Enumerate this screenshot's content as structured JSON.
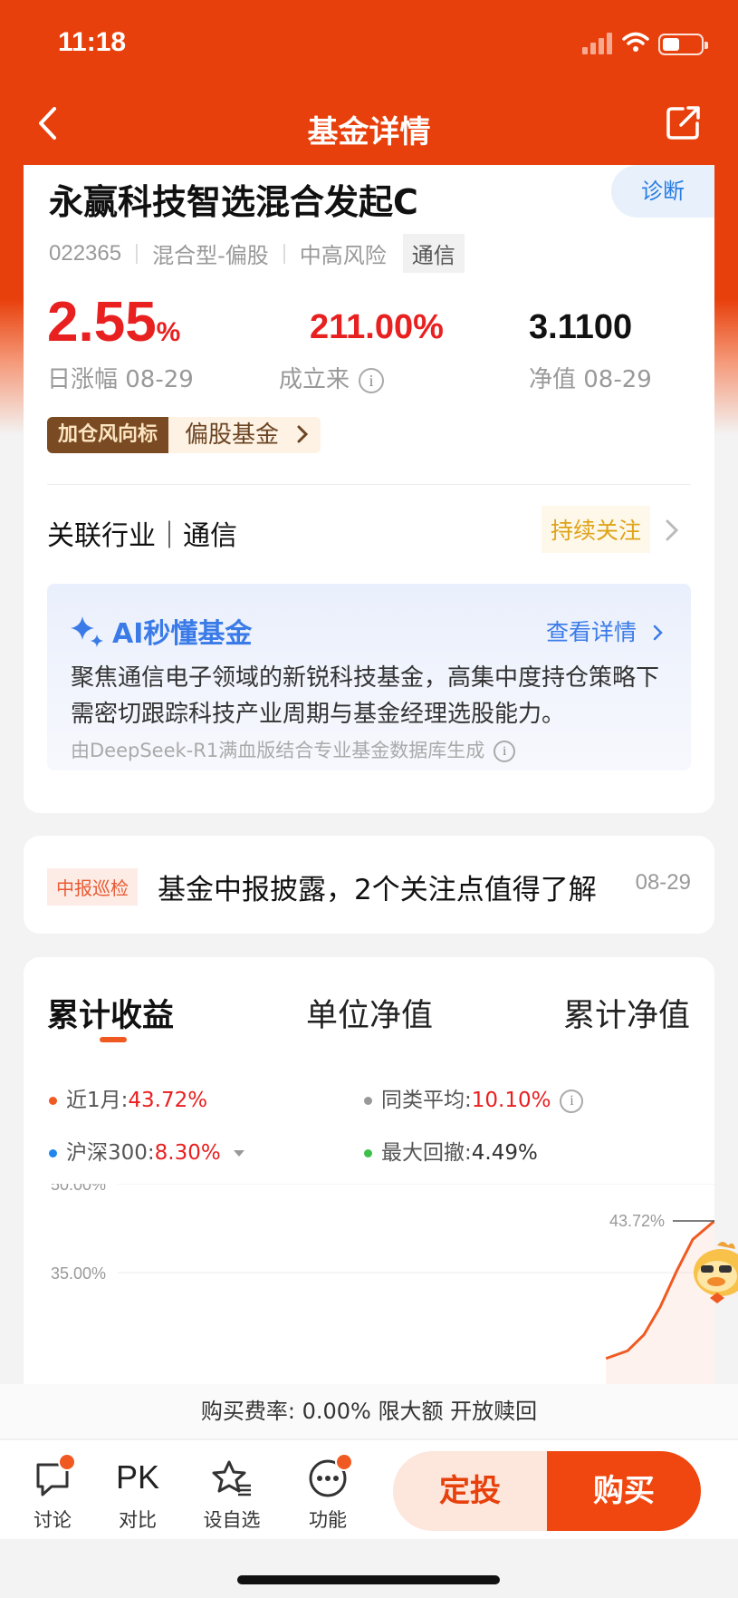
{
  "status_bar": {
    "time": "11:18"
  },
  "nav": {
    "title": "基金详情",
    "back_icon": "chevron-left-icon",
    "share_icon": "share-icon"
  },
  "fund": {
    "name": "永赢科技智选混合发起C",
    "diagnose_label": "诊断",
    "code": "022365",
    "type": "混合型-偏股",
    "risk": "中高风险",
    "tag": "通信",
    "daily_change": "2.55",
    "daily_change_unit": "%",
    "daily_change_label": "日涨幅 08-29",
    "since_inception": "211.00%",
    "since_inception_label": "成立来",
    "nav_value": "3.1100",
    "nav_label": "净值 08-29"
  },
  "promo": {
    "badge": "加仓风向标",
    "text": "偏股基金"
  },
  "industry": {
    "text": "关联行业｜通信",
    "follow_label": "持续关注"
  },
  "ai_summary": {
    "title": "AI秒懂基金",
    "more_label": "查看详情",
    "body": "聚焦通信电子领域的新锐科技基金，高集中度持仓策略下需密切跟踪科技产业周期与基金经理选股能力。",
    "source": "由DeepSeek-R1满血版结合专业基金数据库生成"
  },
  "report": {
    "badge": "中报巡检",
    "text": "基金中报披露，2个关注点值得了解",
    "date": "08-29"
  },
  "performance": {
    "tabs": [
      "累计收益",
      "单位净值",
      "累计净值"
    ],
    "active_tab": 0,
    "legend": [
      {
        "label": "近1月:",
        "value": "43.72%",
        "color": "#f05a22"
      },
      {
        "label": "同类平均:",
        "value": "10.10%",
        "color": "#999999"
      },
      {
        "label": "沪深300:",
        "value": "8.30%",
        "color": "#1f86f0"
      },
      {
        "label": "最大回撤:",
        "value": "4.49%",
        "color": "#3cc04a"
      }
    ]
  },
  "chart_data": {
    "type": "line",
    "y_tick_labels": [
      "50.00%",
      "35.00%"
    ],
    "ylim": [
      20,
      50
    ],
    "end_label": "43.72%",
    "series": [
      {
        "name": "近1月",
        "color": "#f05a22",
        "points": [
          [
            0.9,
            20.5
          ],
          [
            0.94,
            21.8
          ],
          [
            0.97,
            24.5
          ],
          [
            1.0,
            29.2
          ],
          [
            1.03,
            35.2
          ],
          [
            1.06,
            40.6
          ],
          [
            1.1,
            43.72
          ]
        ]
      }
    ]
  },
  "fee_bar": {
    "text": "购买费率: 0.00% 限大额 开放赎回"
  },
  "bottom_bar": {
    "items": [
      {
        "label": "讨论",
        "icon": "chat-icon",
        "badge": true
      },
      {
        "label": "对比",
        "icon": "pk-icon",
        "badge": false
      },
      {
        "label": "设自选",
        "icon": "star-add-icon",
        "badge": false
      },
      {
        "label": "功能",
        "icon": "more-icon",
        "badge": true
      }
    ],
    "sip_label": "定投",
    "buy_label": "购买"
  }
}
